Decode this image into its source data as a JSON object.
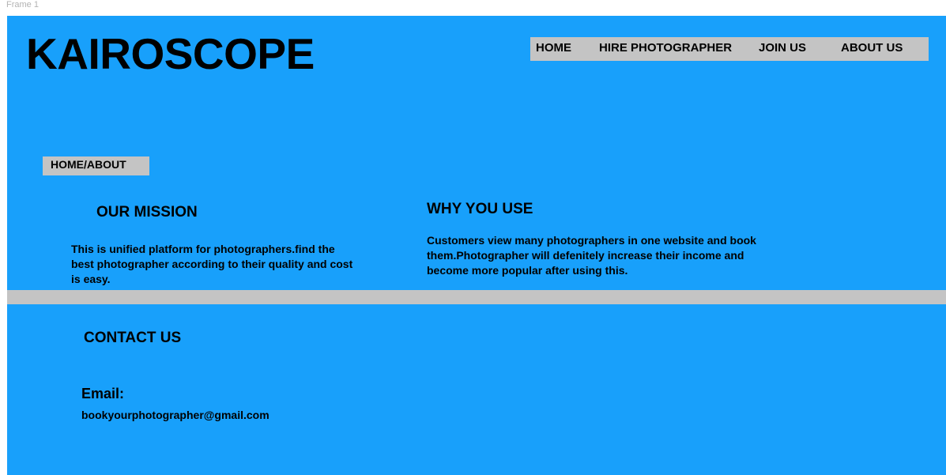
{
  "frame": {
    "label": "Frame 1"
  },
  "header": {
    "logo": "KAIROSCOPE",
    "nav": [
      {
        "label": "HOME"
      },
      {
        "label": "HIRE PHOTOGRAPHER"
      },
      {
        "label": "JOIN US"
      },
      {
        "label": "ABOUT US"
      }
    ]
  },
  "breadcrumb": {
    "text": "HOME/ABOUT"
  },
  "mission": {
    "title": "OUR MISSION",
    "body": "This is unified platform for photographers.find the best photographer according to their quality and cost is easy."
  },
  "why": {
    "title": "WHY YOU USE",
    "body": "Customers view many photographers in one website and book them.Photographer will defenitely increase their income and become more popular after using this."
  },
  "contact": {
    "title": "CONTACT US",
    "email_label": "Email:",
    "email": "bookyourphotographer@gmail.com"
  },
  "colors": {
    "background": "#18a0fb",
    "panel": "#c4c4c4",
    "text": "#000000"
  }
}
